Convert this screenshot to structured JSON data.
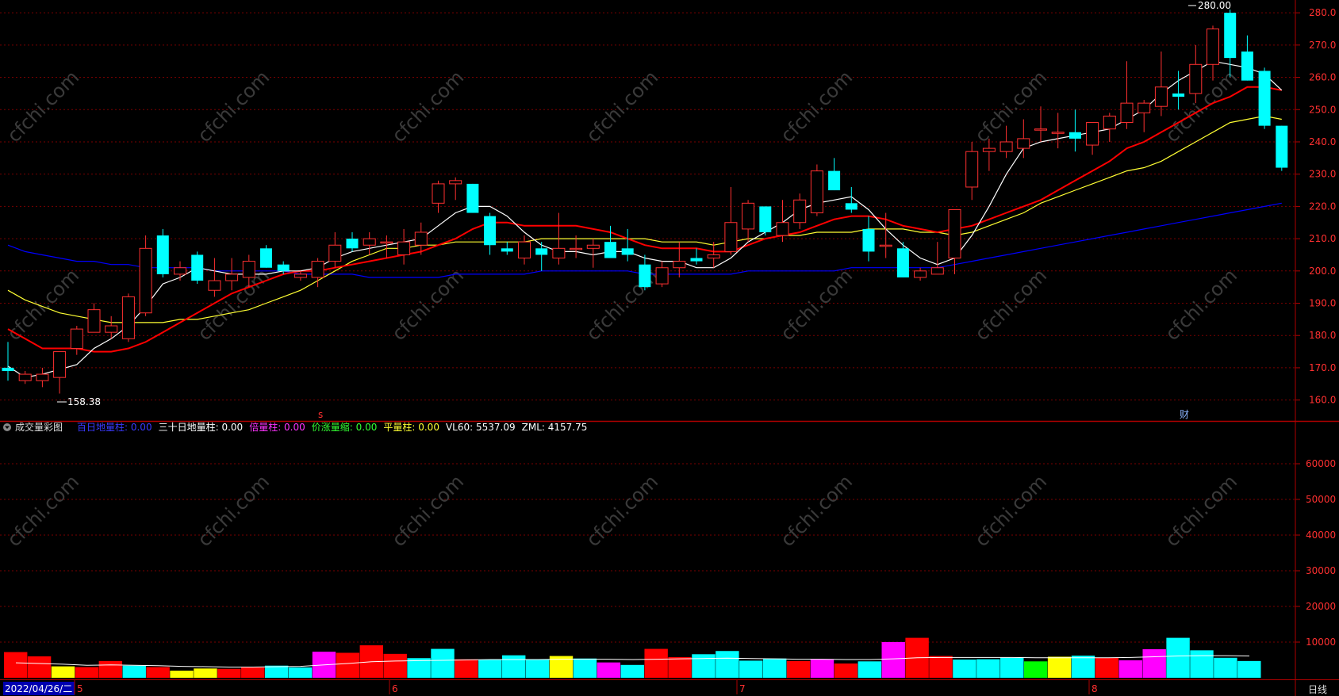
{
  "watermark": "cfchi.com",
  "price_panel": {
    "high_label": "280.00",
    "low_label": "158.38",
    "axis_ticks": [
      160,
      170,
      180,
      190,
      200,
      210,
      220,
      230,
      240,
      250,
      260,
      270,
      280
    ],
    "axis_tick_labels": [
      "160.0",
      "170.0",
      "180.0",
      "190.0",
      "200.0",
      "210.0",
      "220.0",
      "230.0",
      "240.0",
      "250.0",
      "260.0",
      "270.0",
      "280.0"
    ],
    "event_marker_s": "s",
    "event_marker_cai": "财"
  },
  "volume_panel": {
    "indicator_name": "成交量彩图",
    "legend": [
      {
        "label": "百日地量柱:",
        "value": "0.00",
        "color": "#3a3aff"
      },
      {
        "label": "三十日地量柱:",
        "value": "0.00",
        "color": "#ffffff"
      },
      {
        "label": "倍量柱:",
        "value": "0.00",
        "color": "#ff33ff"
      },
      {
        "label": "价涨量缩:",
        "value": "0.00",
        "color": "#33ff33"
      },
      {
        "label": "平量柱:",
        "value": "0.00",
        "color": "#ffff33"
      },
      {
        "label": "VL60:",
        "value": "5537.09",
        "color": "#ffffff"
      },
      {
        "label": "ZML:",
        "value": "4157.75",
        "color": "#ffffff"
      }
    ],
    "axis_ticks": [
      10000,
      20000,
      30000,
      40000,
      50000,
      60000
    ],
    "axis_tick_labels": [
      "10000",
      "20000",
      "30000",
      "40000",
      "50000",
      "60000"
    ]
  },
  "bottom_bar": {
    "date_box": "2022/04/26/二",
    "month_labels": [
      "5",
      "6",
      "7",
      "8"
    ],
    "period": "日线"
  },
  "colors": {
    "up": "#ff3030",
    "down": "#00ffff",
    "ma5": "#ffffff",
    "ma10": "#ff0000",
    "ma20": "#ffff33",
    "ma60": "#0000ff",
    "grid": "#7a0000"
  },
  "chart_data": {
    "type": "candlestick",
    "price_range": [
      155,
      282
    ],
    "volume_range": [
      0,
      70000
    ],
    "candles": [
      {
        "o": 170,
        "h": 178,
        "l": 166,
        "c": 169
      },
      {
        "o": 166,
        "h": 169,
        "l": 165,
        "c": 168
      },
      {
        "o": 166,
        "h": 170,
        "l": 164,
        "c": 168
      },
      {
        "o": 167,
        "h": 175,
        "l": 162,
        "c": 175
      },
      {
        "o": 176,
        "h": 183,
        "l": 174,
        "c": 182
      },
      {
        "o": 181,
        "h": 190,
        "l": 181,
        "c": 188
      },
      {
        "o": 181,
        "h": 186,
        "l": 179,
        "c": 183
      },
      {
        "o": 179,
        "h": 193,
        "l": 178,
        "c": 192
      },
      {
        "o": 187,
        "h": 211,
        "l": 186,
        "c": 207
      },
      {
        "o": 211,
        "h": 213,
        "l": 198,
        "c": 199
      },
      {
        "o": 199,
        "h": 203,
        "l": 197,
        "c": 201
      },
      {
        "o": 205,
        "h": 206,
        "l": 196,
        "c": 197
      },
      {
        "o": 194,
        "h": 204,
        "l": 192,
        "c": 197
      },
      {
        "o": 197,
        "h": 204,
        "l": 194,
        "c": 199
      },
      {
        "o": 198,
        "h": 205,
        "l": 195,
        "c": 203
      },
      {
        "o": 207,
        "h": 208,
        "l": 201,
        "c": 201
      },
      {
        "o": 202,
        "h": 203,
        "l": 199,
        "c": 200
      },
      {
        "o": 198,
        "h": 200,
        "l": 197,
        "c": 199
      },
      {
        "o": 198,
        "h": 204,
        "l": 195,
        "c": 203
      },
      {
        "o": 203,
        "h": 212,
        "l": 201,
        "c": 208
      },
      {
        "o": 210,
        "h": 212,
        "l": 206,
        "c": 207
      },
      {
        "o": 208,
        "h": 212,
        "l": 205,
        "c": 210
      },
      {
        "o": 209,
        "h": 211,
        "l": 204,
        "c": 209
      },
      {
        "o": 205,
        "h": 213,
        "l": 202,
        "c": 209
      },
      {
        "o": 208,
        "h": 215,
        "l": 205,
        "c": 212
      },
      {
        "o": 221,
        "h": 228,
        "l": 218,
        "c": 227
      },
      {
        "o": 227,
        "h": 229,
        "l": 222,
        "c": 228
      },
      {
        "o": 227,
        "h": 227,
        "l": 218,
        "c": 218
      },
      {
        "o": 217,
        "h": 218,
        "l": 205,
        "c": 208
      },
      {
        "o": 207,
        "h": 209,
        "l": 205,
        "c": 206
      },
      {
        "o": 204,
        "h": 211,
        "l": 202,
        "c": 209
      },
      {
        "o": 207,
        "h": 209,
        "l": 200,
        "c": 205
      },
      {
        "o": 204,
        "h": 218,
        "l": 202,
        "c": 207
      },
      {
        "o": 207,
        "h": 211,
        "l": 204,
        "c": 207
      },
      {
        "o": 207,
        "h": 210,
        "l": 201,
        "c": 208
      },
      {
        "o": 209,
        "h": 214,
        "l": 204,
        "c": 204
      },
      {
        "o": 207,
        "h": 213,
        "l": 203,
        "c": 205
      },
      {
        "o": 202,
        "h": 205,
        "l": 194,
        "c": 195
      },
      {
        "o": 196,
        "h": 203,
        "l": 195,
        "c": 201
      },
      {
        "o": 201,
        "h": 209,
        "l": 198,
        "c": 203
      },
      {
        "o": 204,
        "h": 207,
        "l": 202,
        "c": 203
      },
      {
        "o": 204,
        "h": 209,
        "l": 201,
        "c": 205
      },
      {
        "o": 206,
        "h": 226,
        "l": 205,
        "c": 215
      },
      {
        "o": 213,
        "h": 222,
        "l": 209,
        "c": 221
      },
      {
        "o": 220,
        "h": 220,
        "l": 211,
        "c": 212
      },
      {
        "o": 211,
        "h": 222,
        "l": 209,
        "c": 215
      },
      {
        "o": 215,
        "h": 224,
        "l": 213,
        "c": 222
      },
      {
        "o": 218,
        "h": 233,
        "l": 217,
        "c": 231
      },
      {
        "o": 231,
        "h": 235,
        "l": 225,
        "c": 225
      },
      {
        "o": 221,
        "h": 226,
        "l": 218,
        "c": 219
      },
      {
        "o": 213,
        "h": 217,
        "l": 203,
        "c": 206
      },
      {
        "o": 208,
        "h": 218,
        "l": 204,
        "c": 208
      },
      {
        "o": 207,
        "h": 209,
        "l": 198,
        "c": 198
      },
      {
        "o": 198,
        "h": 201,
        "l": 197,
        "c": 200
      },
      {
        "o": 199,
        "h": 209,
        "l": 199,
        "c": 201
      },
      {
        "o": 204,
        "h": 219,
        "l": 199,
        "c": 219
      },
      {
        "o": 226,
        "h": 240,
        "l": 222,
        "c": 237
      },
      {
        "o": 237,
        "h": 241,
        "l": 231,
        "c": 238
      },
      {
        "o": 237,
        "h": 245,
        "l": 235,
        "c": 240
      },
      {
        "o": 238,
        "h": 247,
        "l": 235,
        "c": 241
      },
      {
        "o": 244,
        "h": 251,
        "l": 240,
        "c": 244
      },
      {
        "o": 243,
        "h": 249,
        "l": 238,
        "c": 243
      },
      {
        "o": 243,
        "h": 250,
        "l": 237,
        "c": 241
      },
      {
        "o": 239,
        "h": 246,
        "l": 236,
        "c": 246
      },
      {
        "o": 244,
        "h": 249,
        "l": 240,
        "c": 248
      },
      {
        "o": 246,
        "h": 265,
        "l": 244,
        "c": 252
      },
      {
        "o": 249,
        "h": 253,
        "l": 243,
        "c": 252
      },
      {
        "o": 251,
        "h": 268,
        "l": 248,
        "c": 257
      },
      {
        "o": 255,
        "h": 262,
        "l": 250,
        "c": 254
      },
      {
        "o": 255,
        "h": 270,
        "l": 252,
        "c": 264
      },
      {
        "o": 264,
        "h": 276,
        "l": 259,
        "c": 275
      },
      {
        "o": 280,
        "h": 281,
        "l": 260,
        "c": 266
      },
      {
        "o": 268,
        "h": 273,
        "l": 259,
        "c": 259
      },
      {
        "o": 262,
        "h": 263,
        "l": 244,
        "c": 245
      },
      {
        "o": 245,
        "h": 245,
        "l": 231,
        "c": 232
      }
    ],
    "ma5": [
      170.5,
      167,
      168,
      169.5,
      171,
      176,
      179,
      183,
      189,
      196,
      198,
      201,
      200,
      199,
      199,
      199,
      200,
      200,
      201,
      204,
      206,
      207,
      208,
      209,
      210,
      214,
      218,
      220,
      220,
      217,
      212,
      208,
      206,
      206,
      205,
      206,
      206,
      204,
      203,
      203,
      201,
      201,
      204,
      209,
      212,
      215,
      219,
      221,
      222,
      223,
      219,
      213,
      208,
      204,
      202,
      204,
      211,
      220,
      230,
      238,
      240,
      241,
      242,
      243,
      244,
      247,
      250,
      255,
      259,
      262,
      265,
      264,
      263,
      261,
      256
    ],
    "ma10": [
      182,
      179,
      176,
      176,
      176,
      175,
      175,
      176,
      178,
      181,
      184,
      187,
      190,
      193,
      195,
      197,
      199,
      200,
      200,
      201,
      202,
      203,
      204,
      205,
      206,
      208,
      210,
      213,
      215,
      215,
      214,
      214,
      214,
      214,
      213,
      212,
      210,
      208,
      207,
      207,
      207,
      206,
      206,
      208,
      210,
      211,
      212,
      214,
      216,
      217,
      217,
      216,
      214,
      213,
      212,
      213,
      214,
      216,
      218,
      220,
      222,
      225,
      228,
      231,
      234,
      238,
      240,
      243,
      246,
      249,
      252,
      254,
      257,
      257,
      256
    ],
    "ma20": [
      194,
      191,
      189,
      187,
      186,
      185,
      184,
      184,
      184,
      184,
      185,
      185,
      186,
      187,
      188,
      190,
      192,
      194,
      197,
      200,
      203,
      205,
      207,
      207,
      208,
      208,
      209,
      209,
      209,
      209,
      209,
      210,
      210,
      210,
      210,
      210,
      210,
      210,
      209,
      209,
      209,
      208,
      209,
      210,
      210,
      211,
      211,
      212,
      212,
      212,
      213,
      213,
      213,
      212,
      212,
      211,
      212,
      214,
      216,
      218,
      221,
      223,
      225,
      227,
      229,
      231,
      232,
      234,
      237,
      240,
      243,
      246,
      247,
      248,
      247
    ],
    "ma60": [
      208,
      206,
      205,
      204,
      203,
      203,
      202,
      202,
      201,
      201,
      201,
      201,
      200,
      200,
      200,
      200,
      200,
      199,
      199,
      199,
      199,
      198,
      198,
      198,
      198,
      198,
      199,
      199,
      199,
      199,
      199,
      200,
      200,
      200,
      200,
      200,
      200,
      199,
      199,
      199,
      199,
      199,
      199,
      200,
      200,
      200,
      200,
      200,
      200,
      201,
      201,
      201,
      201,
      201,
      201,
      202,
      203,
      204,
      205,
      206,
      207,
      208,
      209,
      210,
      211,
      212,
      213,
      214,
      215,
      216,
      217,
      218,
      219,
      220,
      221
    ],
    "volumes": [
      7200,
      6000,
      3200,
      3000,
      4700,
      3400,
      3000,
      2000,
      2600,
      2500,
      2900,
      3400,
      2900,
      7300,
      7000,
      9100,
      6700,
      5500,
      8100,
      5200,
      5000,
      6300,
      5100,
      6100,
      5400,
      4300,
      3600,
      8100,
      5800,
      6600,
      7500,
      4800,
      5400,
      4700,
      5200,
      4000,
      4600,
      10000,
      11200,
      6100,
      5100,
      5200,
      5600,
      4600,
      5900,
      6200,
      5600,
      4900,
      8000,
      11200,
      7700,
      5600,
      4700
    ],
    "volume_colors": [
      "red",
      "red",
      "yellow",
      "red",
      "red",
      "cyan",
      "red",
      "yellow",
      "yellow",
      "red",
      "red",
      "cyan",
      "cyan",
      "magenta",
      "red",
      "red",
      "red",
      "cyan",
      "cyan",
      "red",
      "cyan",
      "cyan",
      "cyan",
      "yellow",
      "cyan",
      "magenta",
      "cyan",
      "red",
      "red",
      "cyan",
      "cyan",
      "cyan",
      "cyan",
      "red",
      "magenta",
      "red",
      "cyan",
      "magenta",
      "red",
      "red",
      "cyan",
      "cyan",
      "cyan",
      "green",
      "yellow",
      "cyan",
      "red",
      "magenta",
      "magenta",
      "cyan",
      "cyan",
      "cyan",
      "cyan"
    ],
    "vol_ma": [
      4200,
      4000,
      3800,
      3500,
      3600,
      3500,
      3400,
      3200,
      3100,
      3000,
      3000,
      3100,
      3200,
      3600,
      4000,
      4500,
      4700,
      4800,
      4900,
      5000,
      5100,
      5100,
      5100,
      5200,
      5200,
      5200,
      5100,
      5200,
      5300,
      5400,
      5500,
      5400,
      5300,
      5200,
      5200,
      5100,
      5100,
      5300,
      5600,
      5700,
      5700,
      5700,
      5700,
      5600,
      5600,
      5600,
      5600,
      5700,
      5900,
      6100,
      6200,
      6200,
      6100
    ]
  }
}
